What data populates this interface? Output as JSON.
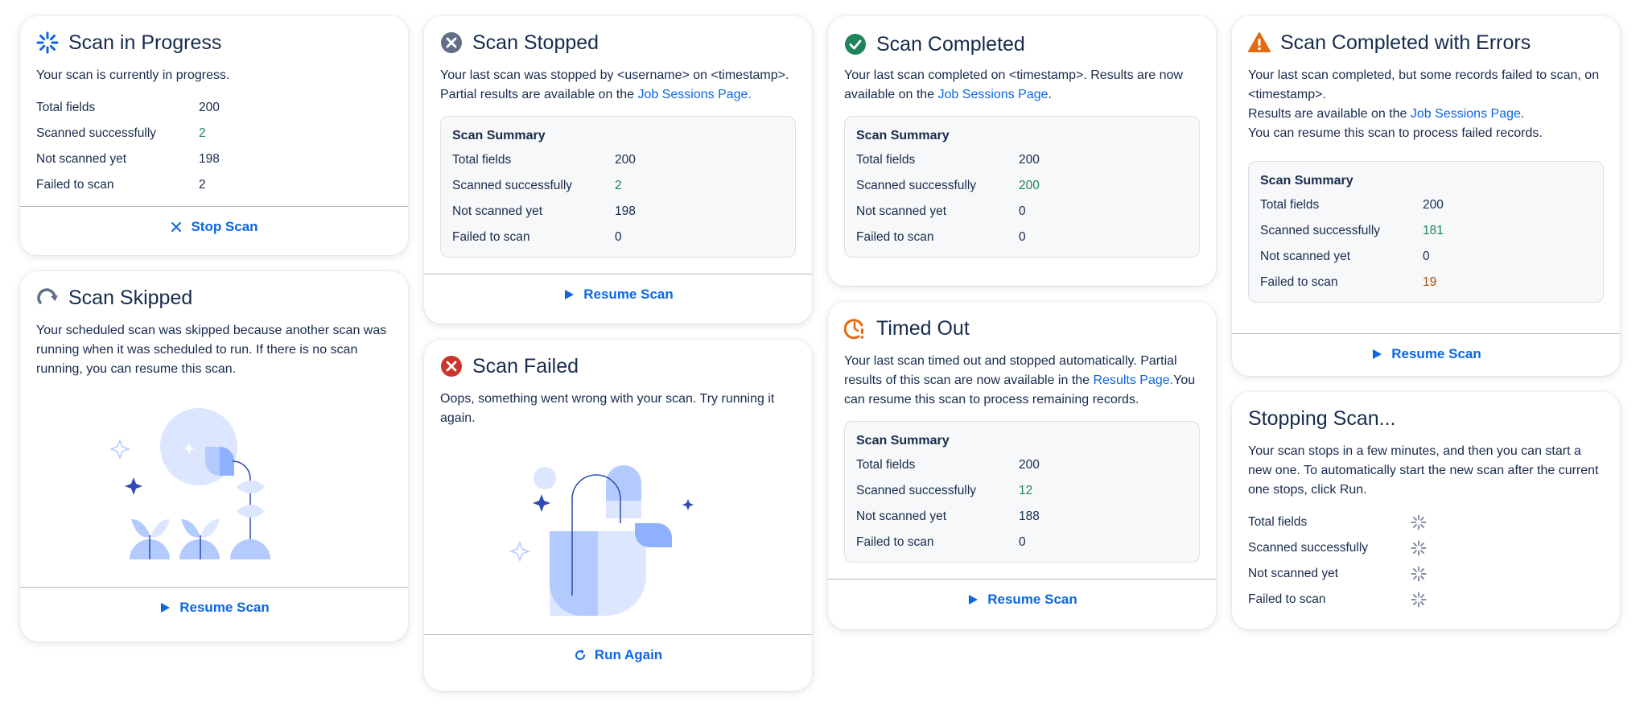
{
  "in_progress": {
    "title": "Scan in Progress",
    "desc": "Your scan is currently in progress.",
    "rows": [
      {
        "label": "Total fields",
        "value": "200"
      },
      {
        "label": "Scanned successfully",
        "value": "2"
      },
      {
        "label": "Not scanned yet",
        "value": "198"
      },
      {
        "label": "Failed to scan",
        "value": "2"
      }
    ],
    "action": "Stop Scan"
  },
  "skipped": {
    "title": "Scan Skipped",
    "desc": "Your scheduled scan was skipped because another scan was running when it was scheduled to run. If there is no scan running, you can resume this scan.",
    "action": "Resume Scan"
  },
  "stopped": {
    "title": "Scan Stopped",
    "desc_pre": "Your last scan was stopped by <username> on <timestamp>. Partial results are available on the ",
    "desc_link": "Job Sessions Page.",
    "summary_title": "Scan Summary",
    "rows": [
      {
        "label": "Total fields",
        "value": "200"
      },
      {
        "label": "Scanned successfully",
        "value": "2"
      },
      {
        "label": "Not scanned yet",
        "value": "198"
      },
      {
        "label": "Failed to scan",
        "value": "0"
      }
    ],
    "action": "Resume Scan"
  },
  "failed": {
    "title": "Scan Failed",
    "desc": "Oops, something went wrong with your scan. Try running it again.",
    "action": "Run Again"
  },
  "completed": {
    "title": "Scan Completed",
    "desc_pre": "Your last scan completed on <timestamp>. Results are now available on the ",
    "desc_link": "Job Sessions Page",
    "desc_post": ".",
    "summary_title": "Scan Summary",
    "rows": [
      {
        "label": "Total fields",
        "value": "200"
      },
      {
        "label": "Scanned successfully",
        "value": "200"
      },
      {
        "label": "Not scanned yet",
        "value": "0"
      },
      {
        "label": "Failed to scan",
        "value": "0"
      }
    ]
  },
  "timed_out": {
    "title": "Timed Out",
    "desc_pre": "Your last scan timed out and stopped automatically. Partial results of this scan are now available in the ",
    "desc_link": "Results Page.",
    "desc_post": "You can resume this scan to process remaining records.",
    "summary_title": "Scan Summary",
    "rows": [
      {
        "label": "Total fields",
        "value": "200"
      },
      {
        "label": "Scanned successfully",
        "value": "12"
      },
      {
        "label": "Not scanned yet",
        "value": "188"
      },
      {
        "label": "Failed to scan",
        "value": "0"
      }
    ],
    "action": "Resume Scan"
  },
  "errors": {
    "title": "Scan Completed with Errors",
    "desc_1": "Your last scan completed, but some records failed to scan, on <timestamp>.",
    "desc_2_pre": "Results are available on the ",
    "desc_2_link": "Job Sessions Page",
    "desc_2_post": ".",
    "desc_3": "You can resume this scan to process failed records.",
    "summary_title": "Scan Summary",
    "rows": [
      {
        "label": "Total fields",
        "value": "200"
      },
      {
        "label": "Scanned successfully",
        "value": "181"
      },
      {
        "label": "Not scanned yet",
        "value": "0"
      },
      {
        "label": "Failed to scan",
        "value": "19"
      }
    ],
    "action": "Resume Scan"
  },
  "stopping": {
    "title": "Stopping Scan...",
    "desc": "Your scan stops in a few minutes, and then you can start a new one. To automatically start the new scan after the current one stops, click Run.",
    "rows": [
      {
        "label": "Total fields"
      },
      {
        "label": "Scanned successfully"
      },
      {
        "label": "Not scanned yet"
      },
      {
        "label": "Failed to scan"
      }
    ]
  },
  "colors": {
    "link": "#0c66e4",
    "success": "#1f845a",
    "warning": "#a54800",
    "danger": "#c9372c",
    "illustration": "#b3caff"
  }
}
